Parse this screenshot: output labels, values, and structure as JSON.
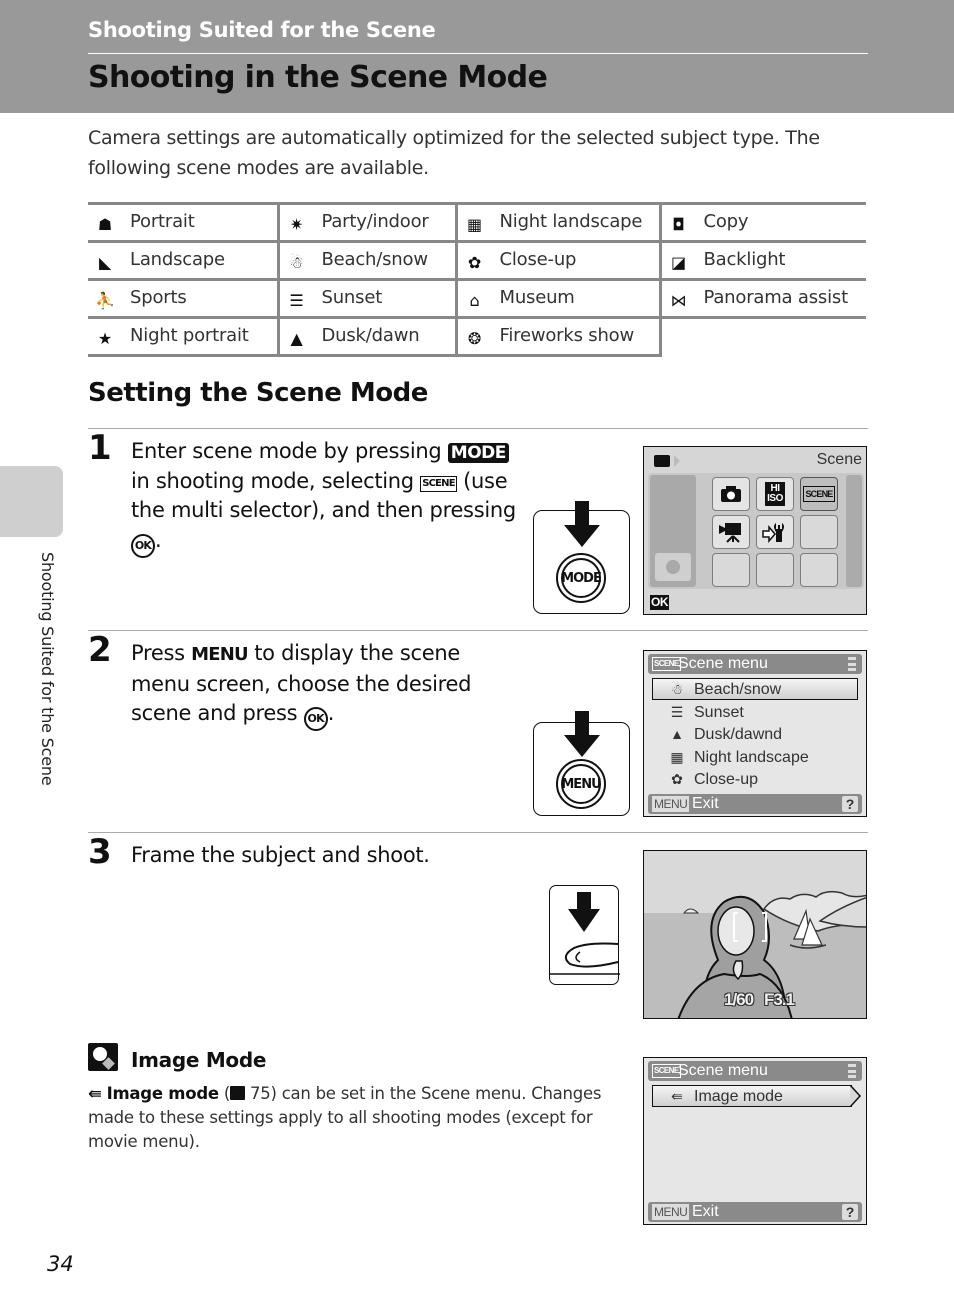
{
  "header": {
    "section_title": "Shooting Suited for the Scene",
    "page_title": "Shooting in the Scene Mode"
  },
  "intro": "Camera settings are automatically optimized for the selected subject type. The following scene modes are available.",
  "scene_modes": {
    "rows": [
      [
        {
          "icon": "portrait-icon",
          "glyph": "☗",
          "label": "Portrait"
        },
        {
          "icon": "party-indoor-icon",
          "glyph": "✷",
          "label": "Party/indoor"
        },
        {
          "icon": "night-landscape-icon",
          "glyph": "▦",
          "label": "Night landscape"
        },
        {
          "icon": "copy-icon",
          "glyph": "◘",
          "label": "Copy"
        }
      ],
      [
        {
          "icon": "landscape-icon",
          "glyph": "◣",
          "label": "Landscape"
        },
        {
          "icon": "beach-snow-icon",
          "glyph": "☃",
          "label": "Beach/snow"
        },
        {
          "icon": "close-up-icon",
          "glyph": "✿",
          "label": "Close-up"
        },
        {
          "icon": "backlight-icon",
          "glyph": "◪",
          "label": "Backlight"
        }
      ],
      [
        {
          "icon": "sports-icon",
          "glyph": "⛹",
          "label": "Sports"
        },
        {
          "icon": "sunset-icon",
          "glyph": "☰",
          "label": "Sunset"
        },
        {
          "icon": "museum-icon",
          "glyph": "⌂",
          "label": "Museum"
        },
        {
          "icon": "panorama-assist-icon",
          "glyph": "⋈",
          "label": "Panorama assist"
        }
      ],
      [
        {
          "icon": "night-portrait-icon",
          "glyph": "★",
          "label": "Night portrait"
        },
        {
          "icon": "dusk-dawn-icon",
          "glyph": "▲",
          "label": "Dusk/dawn"
        },
        {
          "icon": "fireworks-show-icon",
          "glyph": "❂",
          "label": "Fireworks show"
        },
        null
      ]
    ]
  },
  "setting_heading": "Setting the Scene Mode",
  "steps": [
    {
      "number": "1",
      "parts": {
        "a": "Enter scene mode by pressing ",
        "mode_key": "MODE",
        "b": " in shooting mode, selecting ",
        "scene_key": "SCENE",
        "c": " (use the multi selector), and then pressing ",
        "ok_key": "OK",
        "d": "."
      },
      "button_label": "MODE",
      "screen": {
        "title": "Scene",
        "grid": [
          "camera",
          "Hi ISO",
          "SCENE",
          "movie",
          "setup",
          "",
          "",
          "",
          ""
        ],
        "ok_label": "OK"
      }
    },
    {
      "number": "2",
      "parts": {
        "a": "Press ",
        "menu_key": "MENU",
        "b": " to display the scene menu screen, choose the desired scene and press ",
        "ok_key": "OK",
        "d": "."
      },
      "button_label": "MENU",
      "screen": {
        "badge": "SCENE",
        "title": "Scene menu",
        "items": [
          {
            "glyph": "☃",
            "label": "Beach/snow",
            "selected": true
          },
          {
            "glyph": "☰",
            "label": "Sunset"
          },
          {
            "glyph": "▲",
            "label": "Dusk/dawnd"
          },
          {
            "glyph": "▦",
            "label": "Night landscape"
          },
          {
            "glyph": "✿",
            "label": "Close-up"
          }
        ],
        "footer_key": "MENU",
        "footer_label": "Exit",
        "help": "?"
      }
    },
    {
      "number": "3",
      "text": "Frame the subject and shoot.",
      "screen": {
        "shutter": "1/60",
        "aperture": "F3.1"
      }
    }
  ],
  "tip": {
    "title": "Image Mode",
    "bold": "Image mode",
    "ref_page": "75",
    "text_a": " (",
    "text_b": ") can be set in the Scene menu. Changes made to these settings apply to all shooting modes (except for movie menu).",
    "screen": {
      "badge": "SCENE",
      "title": "Scene menu",
      "item": "Image mode",
      "footer_key": "MENU",
      "footer_label": "Exit",
      "help": "?"
    }
  },
  "side_tab_label": "Shooting Suited for the Scene",
  "page_number": "34"
}
